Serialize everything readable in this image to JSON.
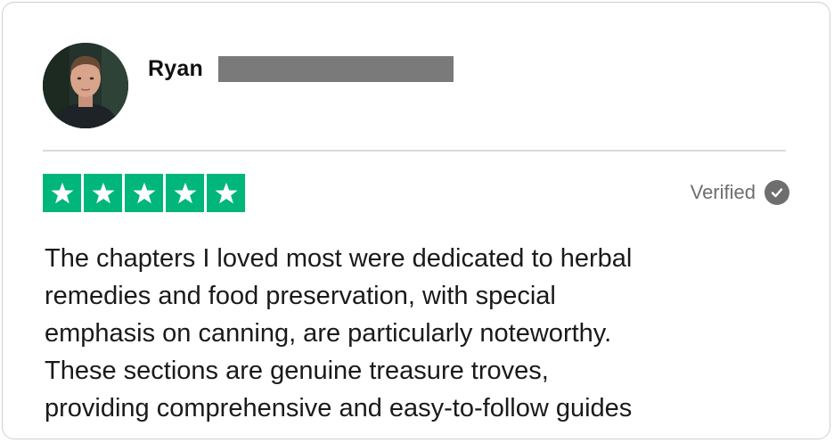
{
  "reviewer": {
    "name": "Ryan",
    "avatar_icon": "user-photo-avatar"
  },
  "rating": {
    "stars": 5,
    "max": 5,
    "star_color": "#00b67a",
    "star_icon": "star-icon"
  },
  "verified": {
    "label": "Verified",
    "icon": "check-circle-icon"
  },
  "review": {
    "lines": [
      "The chapters I loved most were dedicated to herbal",
      "remedies and food preservation, with special",
      "emphasis on canning, are particularly noteworthy.",
      "These sections are genuine treasure troves,",
      "providing comprehensive and easy-to-follow guides"
    ]
  }
}
